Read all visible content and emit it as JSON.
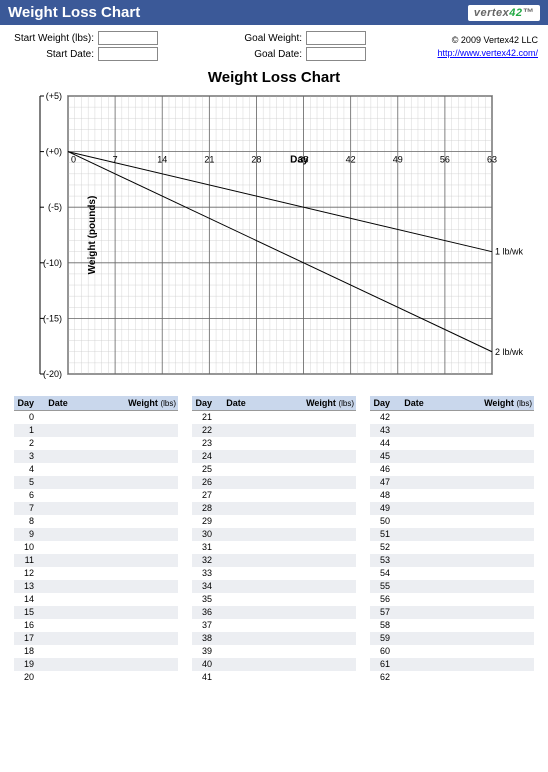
{
  "titlebar": {
    "text": "Weight Loss Chart"
  },
  "logo": {
    "name": "vertex",
    "suffix": "42"
  },
  "form": {
    "left": [
      {
        "label": "Start Weight (lbs):",
        "value": ""
      },
      {
        "label": "Start Date:",
        "value": ""
      }
    ],
    "right": [
      {
        "label": "Goal Weight:",
        "value": ""
      },
      {
        "label": "Goal Date:",
        "value": ""
      }
    ]
  },
  "copyright": {
    "line": "© 2009 Vertex42 LLC",
    "link_text": "http://www.vertex42.com/"
  },
  "chart_title": "Weight Loss Chart",
  "chart_data": {
    "type": "line",
    "title": "Weight Loss Chart",
    "xlabel": "Day",
    "ylabel": "Weight (pounds)",
    "xlim": [
      0,
      63
    ],
    "ylim": [
      -20,
      5
    ],
    "x_ticks": [
      0,
      7,
      14,
      21,
      28,
      35,
      42,
      49,
      56,
      63
    ],
    "y_ticks_labels": [
      "(+5)",
      "(+0)",
      "(-5)",
      "(-10)",
      "(-15)",
      "(-20)"
    ],
    "y_ticks_values": [
      5,
      0,
      -5,
      -10,
      -15,
      -20
    ],
    "series": [
      {
        "name": "1 lb/wk",
        "x": [
          0,
          63
        ],
        "y": [
          0,
          -9
        ]
      },
      {
        "name": "2 lb/wk",
        "x": [
          0,
          63
        ],
        "y": [
          0,
          -18
        ]
      }
    ]
  },
  "tables": {
    "headers": {
      "day": "Day",
      "date": "Date",
      "weight": "Weight",
      "weight_unit": "(lbs)"
    },
    "columns": [
      [
        0,
        1,
        2,
        3,
        4,
        5,
        6,
        7,
        8,
        9,
        10,
        11,
        12,
        13,
        14,
        15,
        16,
        17,
        18,
        19,
        20
      ],
      [
        21,
        22,
        23,
        24,
        25,
        26,
        27,
        28,
        29,
        30,
        31,
        32,
        33,
        34,
        35,
        36,
        37,
        38,
        39,
        40,
        41
      ],
      [
        42,
        43,
        44,
        45,
        46,
        47,
        48,
        49,
        50,
        51,
        52,
        53,
        54,
        55,
        56,
        57,
        58,
        59,
        60,
        61,
        62
      ]
    ]
  }
}
